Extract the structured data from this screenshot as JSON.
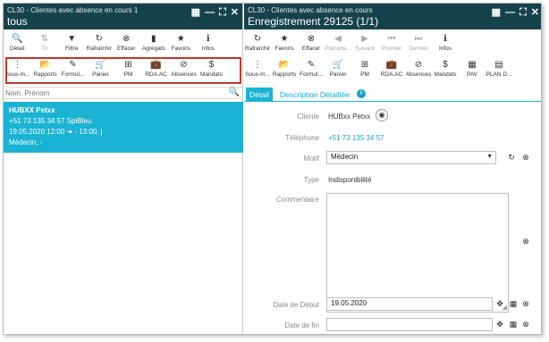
{
  "left": {
    "title_sub": "CL30 - Clientes avec absence en cours 1",
    "title_main": "tous",
    "toolbar1": [
      {
        "label": "Détail",
        "icon": "search-icon",
        "glyph": "🔍",
        "disabled": false
      },
      {
        "label": "Tri",
        "icon": "sort-icon",
        "glyph": "⇅",
        "disabled": true
      },
      {
        "label": "Filtre",
        "icon": "filter-icon",
        "glyph": "▼",
        "disabled": false
      },
      {
        "label": "Rafraîchir",
        "icon": "refresh-icon",
        "glyph": "↻",
        "disabled": false
      },
      {
        "label": "Effacer",
        "icon": "clear-icon",
        "glyph": "⊗",
        "disabled": false
      },
      {
        "label": "Agrégats",
        "icon": "bar-chart-icon",
        "glyph": "▮",
        "disabled": false
      },
      {
        "label": "Favoris",
        "icon": "star-icon",
        "glyph": "★",
        "disabled": false
      },
      {
        "label": "Infos",
        "icon": "info-icon",
        "glyph": "ℹ",
        "disabled": false
      }
    ],
    "toolbar2": [
      {
        "label": "Sous-m...",
        "icon": "more-vertical-icon",
        "glyph": "⋮"
      },
      {
        "label": "Rapports",
        "icon": "folder-icon",
        "glyph": "📂"
      },
      {
        "label": "Formul...",
        "icon": "edit-icon",
        "glyph": "✎"
      },
      {
        "label": "Panier",
        "icon": "cart-icon",
        "glyph": "🛒"
      },
      {
        "label": "PM",
        "icon": "calendar-plus-icon",
        "glyph": "⊞"
      },
      {
        "label": "RDA.AC",
        "icon": "briefcase-icon",
        "glyph": "💼"
      },
      {
        "label": "Absences",
        "icon": "ban-icon",
        "glyph": "⊘"
      },
      {
        "label": "Mandats",
        "icon": "dollar-icon",
        "glyph": "$"
      }
    ],
    "search_placeholder": "Nom, Prénom",
    "record": {
      "name": "HUBXX  Petxx",
      "phone": "+51 73 135 34 57  SpiBleu",
      "time": "19.05.2020 12:00 ➜ - 13:00, j",
      "reason": "Médecin, -"
    }
  },
  "right": {
    "title_sub": "CL30 - Clientes avec absence en cours",
    "title_main": "Enregistrement 29125 (1/1)",
    "toolbar1": [
      {
        "label": "Rafraîchir",
        "icon": "refresh-icon",
        "glyph": "↻",
        "disabled": false
      },
      {
        "label": "Favoris",
        "icon": "star-icon",
        "glyph": "★",
        "disabled": false
      },
      {
        "label": "Effacer",
        "icon": "clear-icon",
        "glyph": "⊗",
        "disabled": false
      },
      {
        "label": "Précéde...",
        "icon": "previous-icon",
        "glyph": "◀",
        "disabled": true
      },
      {
        "label": "Suivant",
        "icon": "next-icon",
        "glyph": "▶",
        "disabled": true
      },
      {
        "label": "Premier",
        "icon": "first-icon",
        "glyph": "⏮",
        "disabled": true
      },
      {
        "label": "Dernier",
        "icon": "last-icon",
        "glyph": "⏭",
        "disabled": true
      },
      {
        "label": "Infos",
        "icon": "info-icon",
        "glyph": "ℹ",
        "disabled": false
      }
    ],
    "toolbar2": [
      {
        "label": "Sous-m...",
        "icon": "more-vertical-icon",
        "glyph": "⋮"
      },
      {
        "label": "Rapports",
        "icon": "folder-icon",
        "glyph": "📂"
      },
      {
        "label": "Formul...",
        "icon": "edit-icon",
        "glyph": "✎"
      },
      {
        "label": "Panier",
        "icon": "cart-icon",
        "glyph": "🛒"
      },
      {
        "label": "PM",
        "icon": "calendar-plus-icon",
        "glyph": "⊞"
      },
      {
        "label": "RDA.AC",
        "icon": "briefcase-icon",
        "glyph": "💼"
      },
      {
        "label": "Absences",
        "icon": "ban-icon",
        "glyph": "⊘"
      },
      {
        "label": "Mandats",
        "icon": "dollar-icon",
        "glyph": "$"
      },
      {
        "label": "PAV",
        "icon": "grid-icon",
        "glyph": "▦"
      },
      {
        "label": "PLAN D...",
        "icon": "document-icon",
        "glyph": "▤"
      }
    ],
    "tabs": {
      "detail": "Détail",
      "description": "Description Détaillée"
    },
    "form": {
      "client_label": "Cliente",
      "client_value": "HUBxx Petxx",
      "phone_label": "Téléphone",
      "phone_value": "+51 73 135 34 57",
      "motif_label": "Motif",
      "motif_value": "Médecin",
      "type_label": "Type",
      "type_value": "Indisponibilité",
      "comment_label": "Commentaire",
      "start_label": "Date de Début",
      "start_value": "19.05.2020",
      "end_label": "Date de fin",
      "end_value": ""
    }
  },
  "colors": {
    "titlebar": "#16434b",
    "accent": "#1bb3d3",
    "highlight": "#c0392b"
  }
}
